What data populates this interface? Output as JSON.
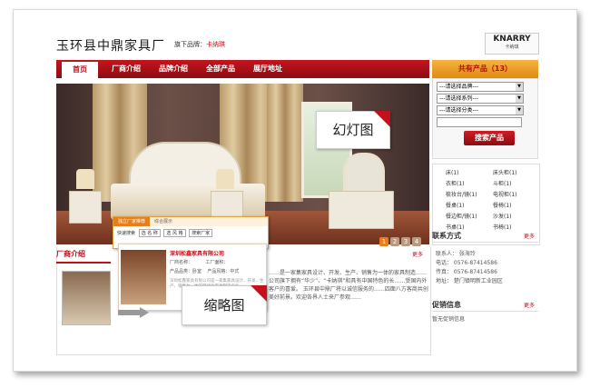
{
  "header": {
    "site_title": "玉环县中鼎家具厂",
    "brand_label": "旗下品牌：",
    "brand_name": "卡纳琪",
    "logo_text": "KNARRY",
    "logo_sub": "卡纳琪"
  },
  "nav": {
    "items": [
      "首页",
      "厂商介绍",
      "品牌介绍",
      "全部产品",
      "展厅地址"
    ]
  },
  "products_panel": {
    "title": "共有产品（13）",
    "select_brand": "---请选择品牌---",
    "select_series": "---请选择系列---",
    "select_category": "---请选择分类---",
    "search_button": "搜索产品",
    "categories": [
      {
        "name": "床",
        "count": "(1)"
      },
      {
        "name": "床头柜",
        "count": "(1)"
      },
      {
        "name": "衣柜",
        "count": "(1)"
      },
      {
        "name": "斗柜",
        "count": "(1)"
      },
      {
        "name": "梳妆台/镜",
        "count": "(1)"
      },
      {
        "name": "电视柜",
        "count": "(1)"
      },
      {
        "name": "餐桌",
        "count": "(1)"
      },
      {
        "name": "餐椅",
        "count": "(1)"
      },
      {
        "name": "餐边柜/镜",
        "count": "(1)"
      },
      {
        "name": "沙发",
        "count": "(1)"
      },
      {
        "name": "书桌",
        "count": "(1)"
      },
      {
        "name": "书椅",
        "count": "(1)"
      }
    ]
  },
  "slideshow": {
    "callout_label": "幻灯图",
    "pages": [
      "1",
      "2",
      "3",
      "4"
    ]
  },
  "overlay_search": {
    "tab_active": "独立厂家推荐",
    "tab_other": "综合展示",
    "row_label": "快速搜索",
    "sel1": "选 名 称",
    "sel2": "选 风 格",
    "sel3": "搜索厂家"
  },
  "about": {
    "title": "厂商介绍",
    "more": "更多",
    "intro": "……是一家集家具设计、开发、生产、销售为一体的家具制造……公司旗下拥有“华少”、“卡纳琪”和具有中国特色的长……受国内外客户的喜爱。 玉环县中鼎厂将以诚信服务的……四面八方客商共创美好前景。欢迎各界人士来厂参观……"
  },
  "card": {
    "company": "深圳松鑫家具有限公司",
    "row1_a": "厂商名称：",
    "row1_b": "工厂面积：",
    "row2_a": "产品品类：卧室",
    "row2_b": "产品风格：中式",
    "desc": "深圳松鑫家具有限公司是一家集家具设计、开发、生产、销售为一体的现代化家具制造企业……",
    "callout_label": "缩略图"
  },
  "contact": {
    "title": "联系方式",
    "more": "更多",
    "person": "联系人：  张海玲",
    "phone": "电话：  0576-87414586",
    "fax": "传真：  0576-87414586",
    "address": "地址：  楚门镇明新工业园区"
  },
  "promo": {
    "title": "促销信息",
    "more": "更多",
    "empty": "暂无促销信息"
  }
}
